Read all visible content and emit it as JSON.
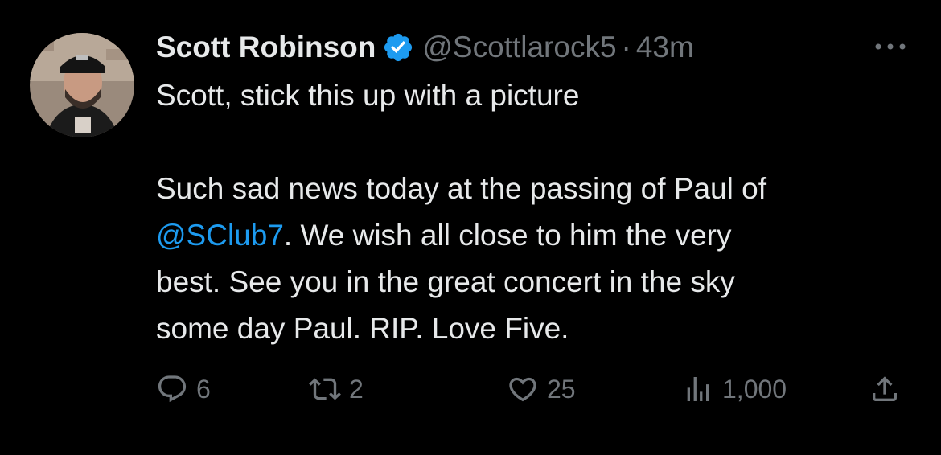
{
  "tweet": {
    "author": {
      "display_name": "Scott Robinson",
      "handle": "@Scottlarock5",
      "verified": true,
      "avatar_icon": "profile-photo"
    },
    "separator": "·",
    "time": "43m",
    "more_icon": "more-horizontal-icon",
    "text": {
      "line1": "Scott, stick this up with a picture",
      "para2_line1": "Such sad news today at the passing of Paul of",
      "mention": "@SClub7",
      "para2_rest_line2": ". We wish all close to him the very",
      "para2_line3": "best. See you in the great concert in the sky",
      "para2_line4": "some day Paul. RIP. Love Five."
    },
    "actions": {
      "reply": {
        "icon": "reply-icon",
        "count": "6"
      },
      "retweet": {
        "icon": "retweet-icon",
        "count": "2"
      },
      "like": {
        "icon": "heart-icon",
        "count": "25"
      },
      "views": {
        "icon": "views-icon",
        "count": "1,000"
      },
      "share": {
        "icon": "share-icon"
      }
    }
  },
  "colors": {
    "background": "#000000",
    "text": "#e7e9ea",
    "secondary": "#71767b",
    "accent": "#1d9bf0"
  }
}
